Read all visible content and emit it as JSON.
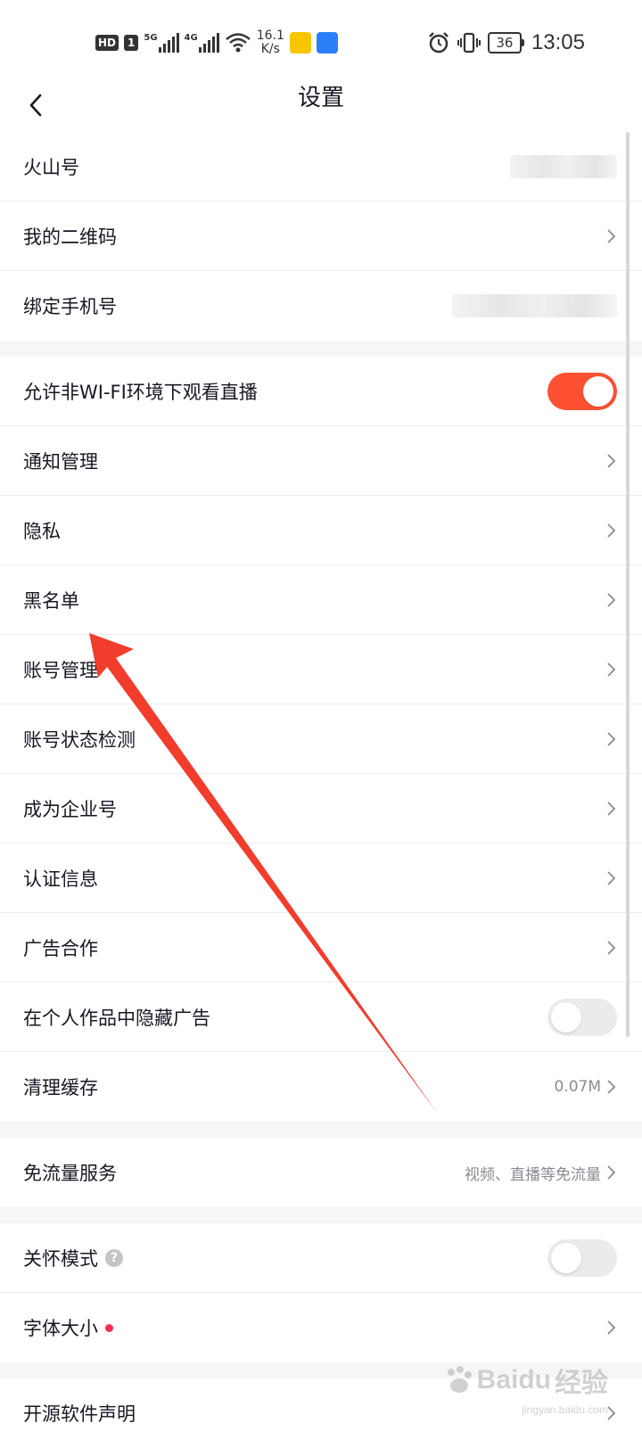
{
  "status_bar": {
    "hd": "HD",
    "sim": "1",
    "net1": "5G",
    "net2": "4G",
    "speed_value": "16.1",
    "speed_unit": "K/s",
    "battery": "36",
    "time": "13:05"
  },
  "nav": {
    "title": "设置"
  },
  "groups": {
    "account": {
      "huoshan_id": "火山号",
      "qr_code": "我的二维码",
      "phone": "绑定手机号"
    },
    "main": {
      "wifi_live": "允许非WI-FI环境下观看直播",
      "notifications": "通知管理",
      "privacy": "隐私",
      "blacklist": "黑名单",
      "account_mgmt": "账号管理",
      "account_status": "账号状态检测",
      "enterprise": "成为企业号",
      "verification": "认证信息",
      "ad_coop": "广告合作",
      "hide_ads": "在个人作品中隐藏广告",
      "clear_cache": "清理缓存",
      "cache_size": "0.07M"
    },
    "data": {
      "free_data": "免流量服务",
      "free_data_desc": "视频、直播等免流量"
    },
    "display": {
      "care_mode": "关怀模式",
      "font_size": "字体大小"
    },
    "about": {
      "open_source": "开源软件声明"
    }
  },
  "toggles": {
    "wifi_live": true,
    "hide_ads": false,
    "care_mode": false
  },
  "colors": {
    "accent": "#fe5133",
    "annotation_arrow": "#f23c2c",
    "dot": "#fe2c55"
  },
  "watermark": {
    "brand": "Baidu",
    "suffix": "经验",
    "site": "jingyan.baidu.com"
  }
}
